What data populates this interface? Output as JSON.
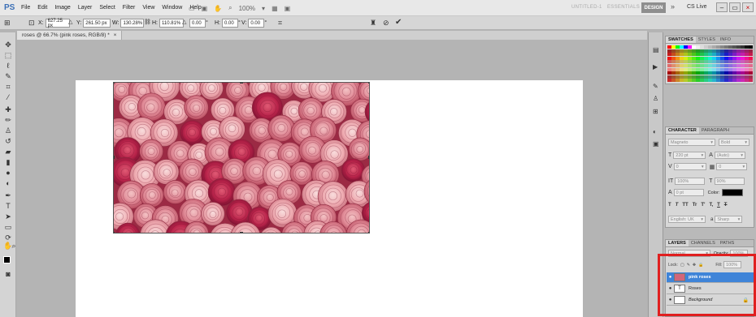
{
  "menubar": {
    "logo": "PS",
    "menus": [
      "File",
      "Edit",
      "Image",
      "Layer",
      "Select",
      "Filter",
      "View",
      "Window",
      "Help"
    ],
    "zoom": "100%",
    "workspaces": [
      "UNTITLED-1",
      "ESSENTIALS",
      "DESIGN"
    ],
    "cs_live": "CS Live",
    "more": "»"
  },
  "options": {
    "x_label": "X:",
    "x_value": "627.25 px",
    "y_label": "Y:",
    "y_value": "261.50 px",
    "w_label": "W:",
    "w_value": "130.28%",
    "h_label": "H:",
    "h_value": "110.81%",
    "rot_value": "0.00",
    "h2_label": "H:",
    "h2_value": "0.00",
    "v_label": "V:",
    "v_value": "0.00",
    "degree": "°"
  },
  "document": {
    "tab_title": "roses @ 66.7% (pink roses, RGB/8) *",
    "close": "×"
  },
  "colors": {
    "accent": "#3c7fd6",
    "highlight": "#e01f1f",
    "selected_layer": "#3f84d8"
  },
  "swatches_panel": {
    "tabs": [
      "SWATCHES",
      "STYLES",
      "INFO"
    ]
  },
  "character": {
    "tabs": [
      "CHARACTER",
      "PARAGRAPH"
    ],
    "font_family": "Magneto",
    "font_style": "Bold",
    "font_size": "220 pt",
    "leading": "(Auto)",
    "kerning": "0",
    "tracking": "0",
    "v_scale": "100%",
    "h_scale": "90%",
    "baseline": "0 pt",
    "color_label": "Color:",
    "style_buttons": [
      "T",
      "T",
      "TT",
      "Tr",
      "T'",
      "T,",
      "T",
      "T"
    ],
    "language": "English: UK",
    "aa_icon": "a",
    "antialias": "Sharp"
  },
  "layers_panel": {
    "tabs": [
      "LAYERS",
      "CHANNELS",
      "PATHS"
    ],
    "blend_mode": "Normal",
    "opacity_label": "Opacity:",
    "opacity": "100%",
    "lock_label": "Lock:",
    "fill_label": "Fill:",
    "fill": "100%",
    "layers": [
      {
        "name": "pink roses",
        "selected": true,
        "type": "image"
      },
      {
        "name": "Roses",
        "selected": false,
        "type": "text",
        "thumb": "T"
      },
      {
        "name": "Background",
        "selected": false,
        "type": "background"
      }
    ]
  }
}
